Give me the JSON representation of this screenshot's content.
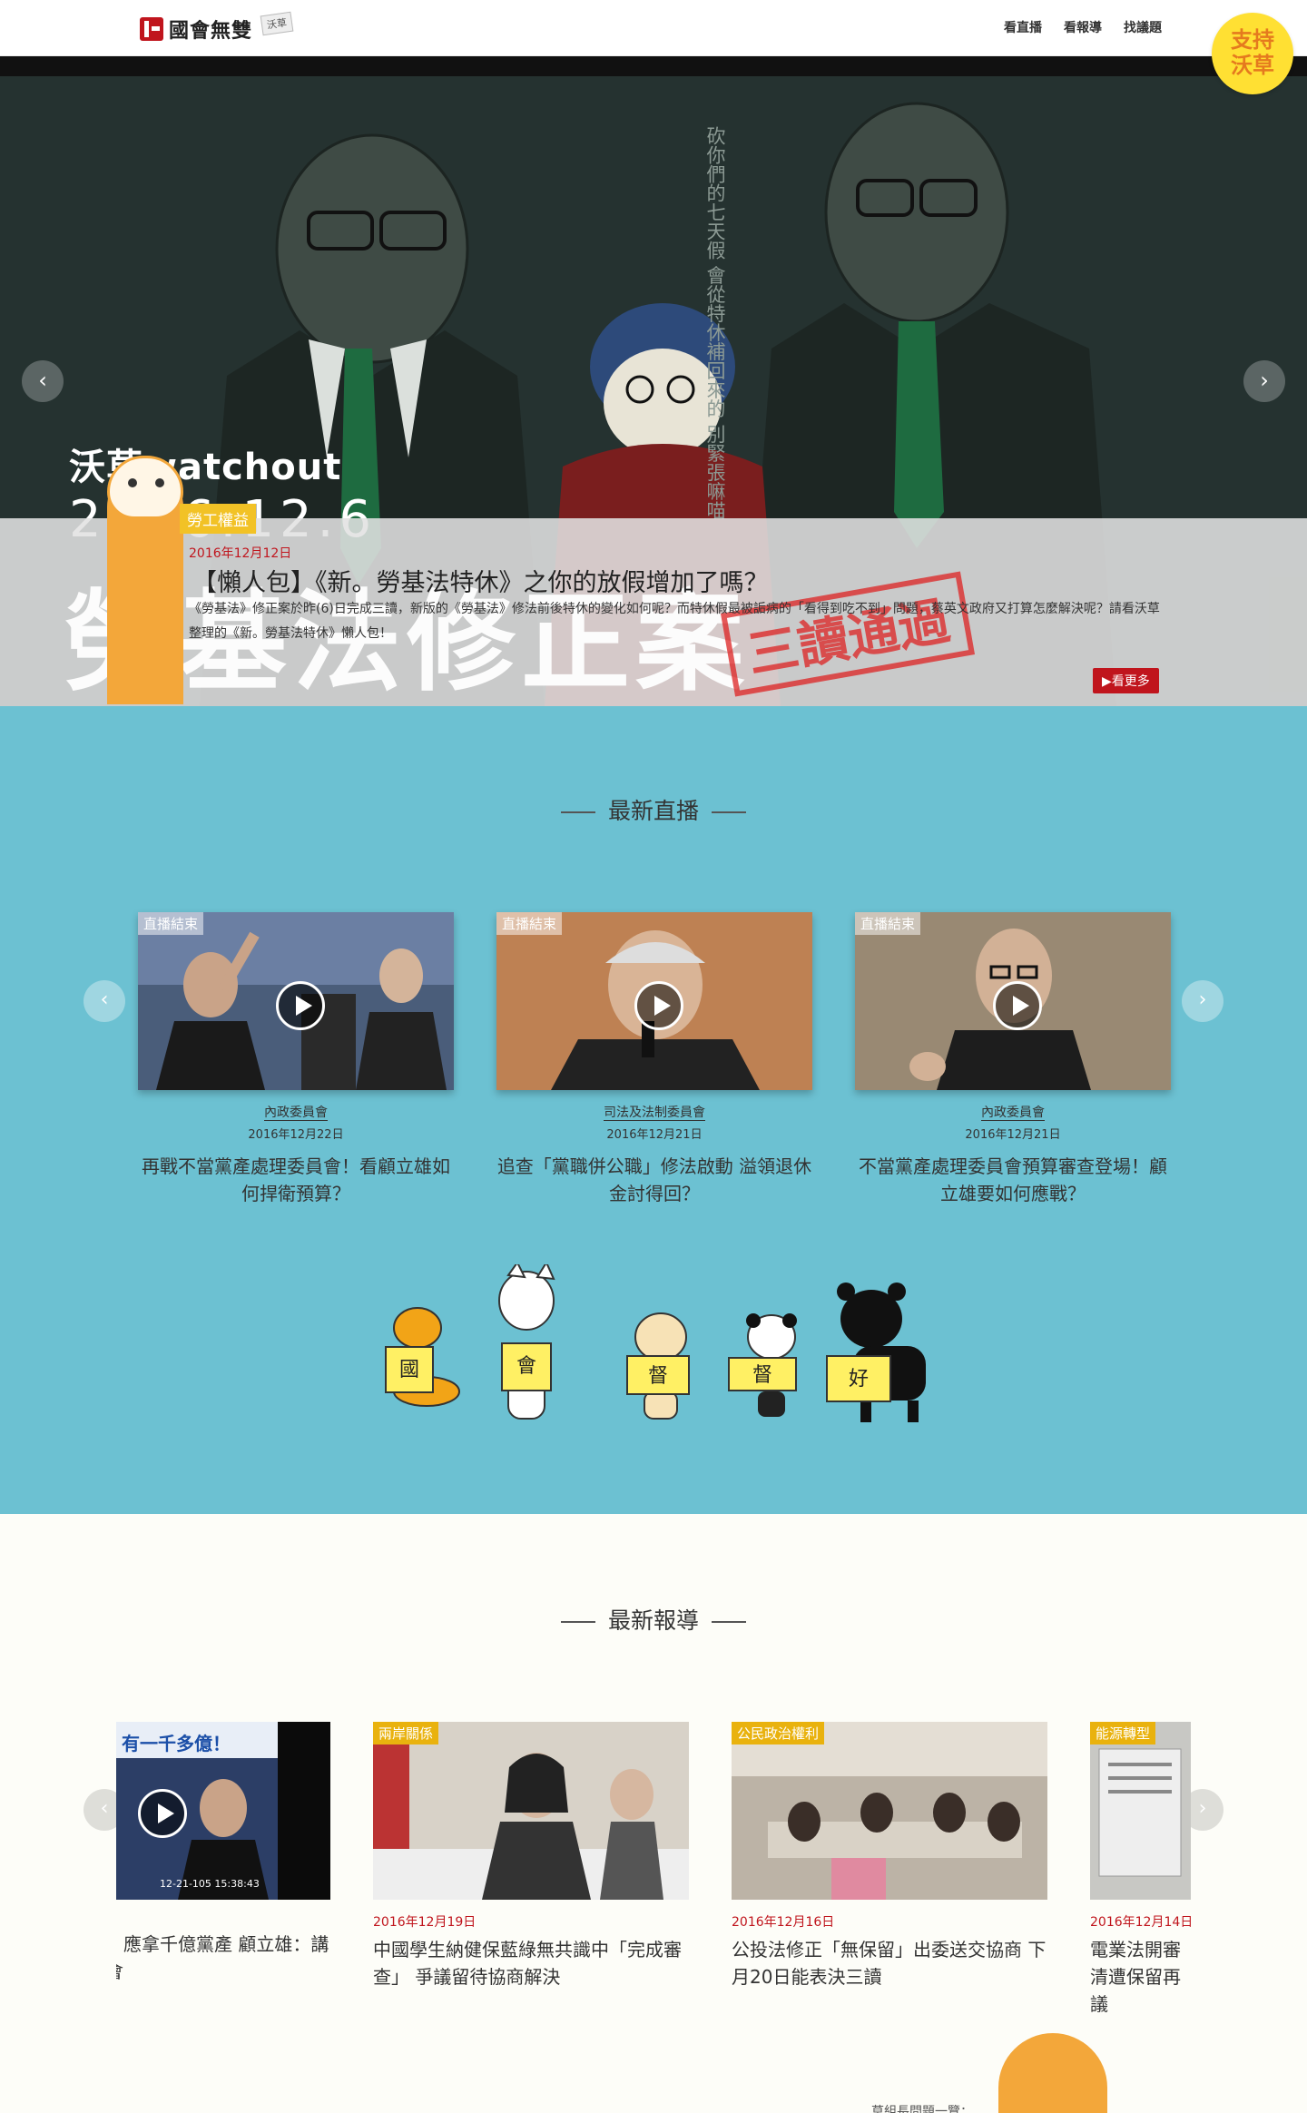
{
  "header": {
    "logo_text": "國會無雙",
    "logo_tag": "沃草",
    "nav": [
      "看直播",
      "看報導",
      "找議題"
    ],
    "support_line1": "支持",
    "support_line2": "沃草"
  },
  "hero": {
    "watchout": "沃草watchout",
    "big_date": "2016.12.6",
    "big_text": "勞基法修正案",
    "stamp": "三讀通過",
    "tag": "勞工權益",
    "date": "2016年12月12日",
    "title": "【懶人包】《新。勞基法特休》之你的放假增加了嗎？",
    "desc": "《勞基法》修正案於昨(6)日完成三讀，新版的《勞基法》修法前後特休的變化如何呢？而特休假最被詬病的「看得到吃不到」問題，蔡英文政府又打算怎麼解決呢？請看沃草整理的《新。勞基法特休》懶人包！",
    "vertical_text": "砍你們的七天假 會從特休補回來的 別緊張嘛喵",
    "more": "▶看更多"
  },
  "live": {
    "title": "最新直播",
    "cards": [
      {
        "badge": "直播結束",
        "committee": "內政委員會",
        "date": "2016年12月22日",
        "title": "再戰不當黨產處理委員會！看顧立雄如何捍衛預算？"
      },
      {
        "badge": "直播結束",
        "committee": "司法及法制委員會",
        "date": "2016年12月21日",
        "title": "追查「黨職併公職」修法啟動 溢領退休金討得回？"
      },
      {
        "badge": "直播結束",
        "committee": "內政委員會",
        "date": "2016年12月21日",
        "title": "不當黨產處理委員會預算審查登場！顧立雄要如何應戰？"
      }
    ],
    "signs": [
      "國",
      "會",
      "督",
      "督",
      "好"
    ]
  },
  "news": {
    "title": "最新報導",
    "cards": [
      {
        "tag": "",
        "thumb_text": "有一千多億！",
        "thumb_time": "12-21-105 15:38:43",
        "date": "",
        "title": "藍委林為洲：應拿千億黨產 顧立雄：講千億國民黨會"
      },
      {
        "tag": "兩岸關係",
        "date": "2016年12月19日",
        "title": "中國學生納健保藍綠無共識中「完成審查」 爭議留待協商解決"
      },
      {
        "tag": "公民政治權利",
        "date": "2016年12月16日",
        "title": "公投法修正「無保留」出委送交協商 下月20日能表決三讀"
      },
      {
        "tag": "能源轉型",
        "date": "2016年12月14日",
        "title": "電業法開審 清遭保留再議"
      }
    ]
  },
  "footer": {
    "text": "草組長問題一覽："
  }
}
